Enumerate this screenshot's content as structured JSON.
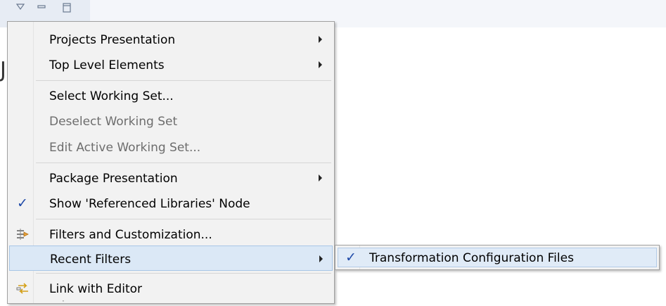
{
  "menu": {
    "items": [
      {
        "label": "Projects Presentation"
      },
      {
        "label": "Top Level Elements"
      },
      {
        "label": "Select Working Set..."
      },
      {
        "label": "Deselect Working Set"
      },
      {
        "label": "Edit Active Working Set..."
      },
      {
        "label": "Package Presentation"
      },
      {
        "label": "Show 'Referenced Libraries' Node"
      },
      {
        "label": "Filters and Customization..."
      },
      {
        "label": "Recent Filters"
      },
      {
        "label": "Link with Editor"
      }
    ]
  },
  "submenu": {
    "items": [
      {
        "label": "Transformation Configuration Files"
      }
    ]
  },
  "icons": {
    "view_menu": "triangle-down-icon",
    "minimize": "minimize-icon",
    "maximize": "maximize-icon",
    "checked": "checkmark-icon",
    "filters": "filter-icon",
    "link": "link-editor-icon"
  },
  "colors": {
    "menu_bg": "#f2f2f2",
    "highlight_bg": "#dbe8f6",
    "check": "#1e49a8",
    "disabled_text": "#6d6d6d"
  }
}
